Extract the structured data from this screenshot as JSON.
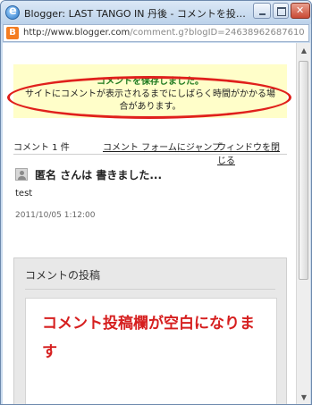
{
  "window": {
    "title": "Blogger: LAST TANGO IN 丹後 - コメントを投…"
  },
  "address": {
    "url_host": "http://www.blogger.com",
    "url_path": "/comment.g?blogID=24638962687610"
  },
  "notice": {
    "title": "コメントを保存しました。",
    "body": "サイトにコメントが表示されるまでにしばらく時間がかかる場合があります。"
  },
  "comments": {
    "count_label": "コメント 1 件",
    "jump_link": "コメント フォームにジャンプ",
    "close_link": "ウィンドウを閉じる",
    "items": [
      {
        "author_line": "匿名 さんは 書きました...",
        "body": "test",
        "timestamp": "2011/10/05 1:12:00"
      }
    ]
  },
  "post_form": {
    "header": "コメントの投稿",
    "annotation": "コメント投稿欄が空白になります"
  },
  "colors": {
    "notice_bg": "#fffec9",
    "notice_title": "#1f7a1f",
    "annotation_red": "#d61f1f",
    "highlight_ellipse": "#e0201c"
  },
  "icons": {
    "browser": "ie-icon",
    "page": "blogger-icon",
    "author": "anonymous-user-icon"
  }
}
